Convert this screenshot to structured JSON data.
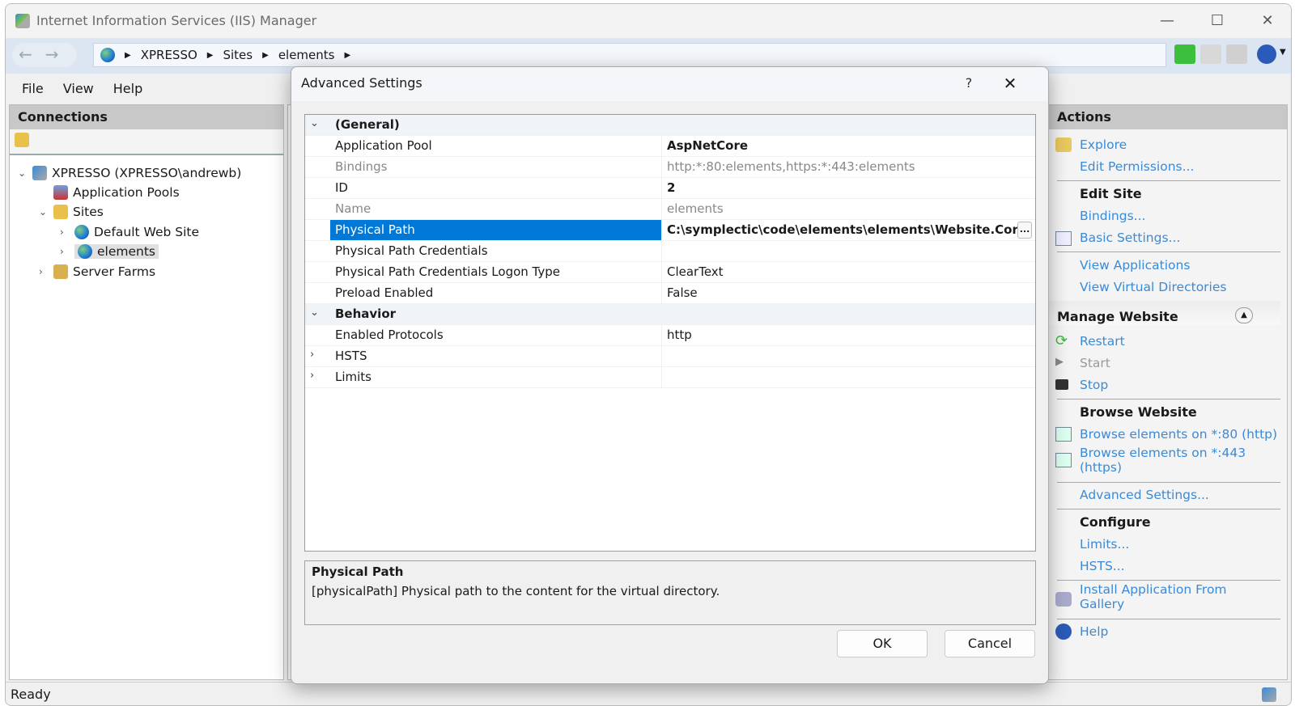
{
  "window": {
    "title": "Internet Information Services (IIS) Manager",
    "minimize": "—",
    "maximize": "☐",
    "close": "✕"
  },
  "nav": {
    "back": "←",
    "forward": "→",
    "breadcrumb": [
      "XPRESSO",
      "Sites",
      "elements"
    ]
  },
  "menu": [
    "File",
    "View",
    "Help"
  ],
  "connections": {
    "title": "Connections",
    "tree": [
      {
        "label": "XPRESSO (XPRESSO\\andrewb)",
        "toggle": "⌄"
      },
      {
        "label": "Application Pools",
        "toggle": ""
      },
      {
        "label": "Sites",
        "toggle": "⌄"
      },
      {
        "label": "Default Web Site",
        "toggle": "›"
      },
      {
        "label": "elements",
        "toggle": "›"
      },
      {
        "label": "Server Farms",
        "toggle": "›"
      }
    ]
  },
  "actions": {
    "title": "Actions",
    "explore": "Explore",
    "edit_permissions": "Edit Permissions...",
    "edit_site": "Edit Site",
    "bindings": "Bindings...",
    "basic_settings": "Basic Settings...",
    "view_applications": "View Applications",
    "view_virtual_directories": "View Virtual Directories",
    "manage_website": "Manage Website",
    "restart": "Restart",
    "start": "Start",
    "stop": "Stop",
    "browse_website": "Browse Website",
    "browse_http": "Browse elements on *:80 (http)",
    "browse_https_1": "Browse elements on *:443",
    "browse_https_2": "(https)",
    "advanced_settings": "Advanced Settings...",
    "configure": "Configure",
    "limits": "Limits...",
    "hsts": "HSTS...",
    "install_1": "Install Application From",
    "install_2": "Gallery",
    "help": "Help"
  },
  "status": "Ready",
  "dialog": {
    "title": "Advanced Settings",
    "help": "?",
    "close": "✕",
    "rows": [
      {
        "name": "(General)",
        "value": "",
        "toggle": "⌄"
      },
      {
        "name": "Application Pool",
        "value": "AspNetCore"
      },
      {
        "name": "Bindings",
        "value": "http:*:80:elements,https:*:443:elements"
      },
      {
        "name": "ID",
        "value": "2"
      },
      {
        "name": "Name",
        "value": "elements"
      },
      {
        "name": "Physical Path",
        "value": "C:\\symplectic\\code\\elements\\elements\\Website.Core"
      },
      {
        "name": "Physical Path Credentials",
        "value": ""
      },
      {
        "name": "Physical Path Credentials Logon Type",
        "value": "ClearText"
      },
      {
        "name": "Preload Enabled",
        "value": "False"
      },
      {
        "name": "Behavior",
        "value": "",
        "toggle": "⌄"
      },
      {
        "name": "Enabled Protocols",
        "value": "http"
      },
      {
        "name": "HSTS",
        "value": "",
        "toggle": "›"
      },
      {
        "name": "Limits",
        "value": "",
        "toggle": "›"
      }
    ],
    "ellipsis": "...",
    "description": {
      "title": "Physical Path",
      "text": "[physicalPath] Physical path to the content for the virtual directory."
    },
    "ok": "OK",
    "cancel": "Cancel"
  },
  "colors": {
    "selection": "#0078d7",
    "link": "#3a8ad6"
  }
}
